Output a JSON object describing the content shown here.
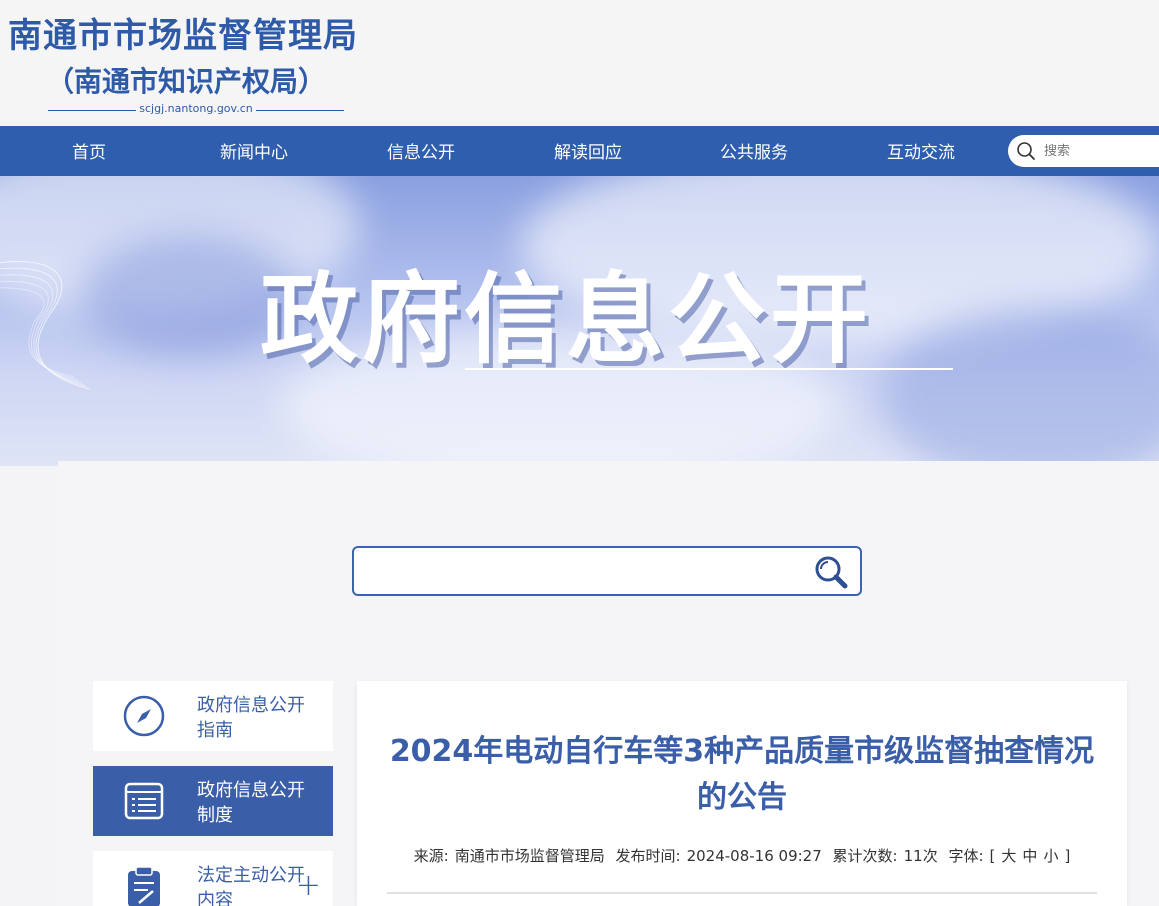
{
  "header": {
    "title": "南通市市场监督管理局",
    "subtitle": "（南通市知识产权局）",
    "domain": "scjgj.nantong.gov.cn"
  },
  "nav": {
    "items": [
      "首页",
      "新闻中心",
      "信息公开",
      "解读回应",
      "公共服务",
      "互动交流"
    ],
    "search_placeholder": "搜索"
  },
  "banner": {
    "title": "政府信息公开"
  },
  "main_search": {
    "value": ""
  },
  "sidebar": {
    "items": [
      {
        "label": "政府信息公开指南",
        "icon": "compass-icon"
      },
      {
        "label": "政府信息公开制度",
        "icon": "document-list-icon"
      },
      {
        "label": "法定主动公开内容",
        "icon": "clipboard-edit-icon",
        "expand": "+"
      }
    ]
  },
  "article": {
    "title": "2024年电动自行车等3种产品质量市级监督抽查情况的公告",
    "source_label": "来源:",
    "source": "南通市市场监督管理局",
    "date_label": "发布时间:",
    "date": "2024-08-16 09:27",
    "views_label": "累计次数:",
    "views": "11次",
    "font_label": "字体:",
    "font_open": "[",
    "font_large": "大",
    "font_medium": "中",
    "font_small": "小",
    "font_close": "]"
  },
  "colors": {
    "brand": "#2e5aa8",
    "nav_bg": "#2f5eae",
    "active_side": "#3a5ea8"
  }
}
